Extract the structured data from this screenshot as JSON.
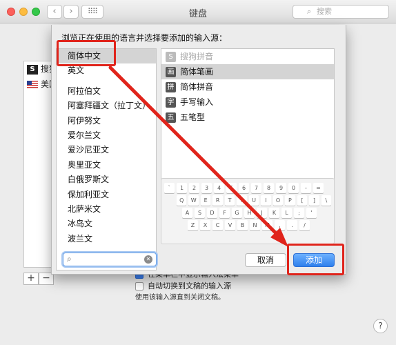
{
  "window": {
    "title": "键盘",
    "search_placeholder": "搜索",
    "back_glyph": "‹",
    "forward_glyph": "›",
    "grid_glyph": "⠿⠿"
  },
  "background": {
    "sources": [
      {
        "label": "搜狗",
        "icon": "sogou-icon"
      },
      {
        "label": "美国",
        "icon": "us-flag-icon"
      }
    ],
    "add_glyph": "+",
    "remove_glyph": "−",
    "option_menu_label": "在菜单栏中显示输入法菜单",
    "option_autoswitch_label": "自动切换到文稿的输入源",
    "option_hint": "使用该输入源直到关闭文稿。",
    "help_glyph": "?"
  },
  "sheet": {
    "title": "浏览正在使用的语言并选择要添加的输入源：",
    "languages_pinned": [
      "简体中文",
      "英文"
    ],
    "languages": [
      "阿拉伯文",
      "阿塞拜疆文（拉丁文）",
      "阿伊努文",
      "爱尔兰文",
      "爱沙尼亚文",
      "奥里亚文",
      "白俄罗斯文",
      "保加利亚文",
      "北萨米文",
      "冰岛文",
      "波兰文"
    ],
    "selected_language": "简体中文",
    "sources": [
      {
        "label": "搜狗拼音",
        "icon_glyph": "S",
        "icon": "sogou-icon",
        "disabled": true
      },
      {
        "label": "简体笔画",
        "icon_glyph": "画",
        "icon": "stroke-icon",
        "disabled": false
      },
      {
        "label": "简体拼音",
        "icon_glyph": "拼",
        "icon": "pinyin-icon",
        "disabled": false
      },
      {
        "label": "手写输入",
        "icon_glyph": "字",
        "icon": "handwriting-icon",
        "disabled": false
      },
      {
        "label": "五笔型",
        "icon_glyph": "五",
        "icon": "wubi-icon",
        "disabled": false
      }
    ],
    "selected_source": "简体笔画",
    "keyboard_rows": [
      [
        "`",
        "1",
        "2",
        "3",
        "4",
        "5",
        "6",
        "7",
        "8",
        "9",
        "0",
        "-",
        "="
      ],
      [
        "Q",
        "W",
        "E",
        "R",
        "T",
        "Y",
        "U",
        "I",
        "O",
        "P",
        "[",
        "]",
        "\\"
      ],
      [
        "A",
        "S",
        "D",
        "F",
        "G",
        "H",
        "J",
        "K",
        "L",
        ";",
        "'"
      ],
      [
        "Z",
        "X",
        "C",
        "V",
        "B",
        "N",
        "M",
        ",",
        ".",
        "/"
      ]
    ],
    "search_clear_glyph": "✕",
    "cancel_label": "取消",
    "add_label": "添加",
    "accent_color": "#2f80ed",
    "annotation_color": "#e0241b"
  }
}
